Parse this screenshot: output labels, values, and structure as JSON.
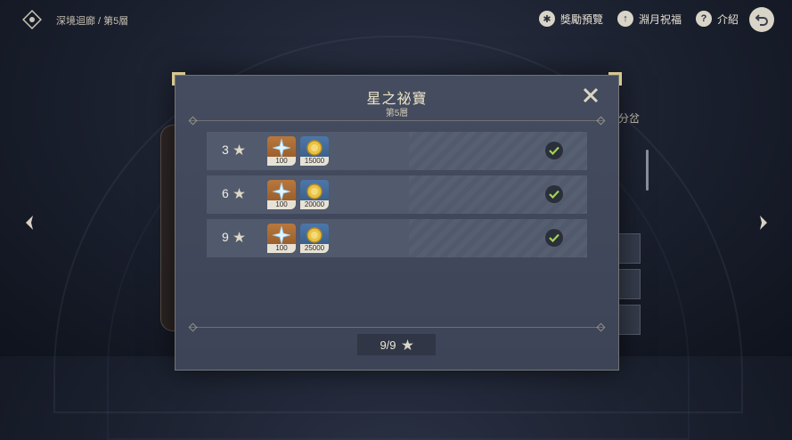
{
  "topbar": {
    "breadcrumb": "深境迴廊 / 第5層",
    "actions": [
      {
        "label": "獎勵預覽",
        "icon": "star-badge-icon"
      },
      {
        "label": "淵月祝福",
        "icon": "upload-arrow-icon"
      },
      {
        "label": "介紹",
        "icon": "question-icon"
      }
    ],
    "back_icon": "back-arrow-icon"
  },
  "background": {
    "right_label": "分岔"
  },
  "modal": {
    "title": "星之祕寶",
    "subtitle": "第5層",
    "rows": [
      {
        "stars": "3",
        "rewards": [
          {
            "type": "primogem",
            "qty": "100"
          },
          {
            "type": "mora",
            "qty": "15000"
          }
        ],
        "claimed": true
      },
      {
        "stars": "6",
        "rewards": [
          {
            "type": "primogem",
            "qty": "100"
          },
          {
            "type": "mora",
            "qty": "20000"
          }
        ],
        "claimed": true
      },
      {
        "stars": "9",
        "rewards": [
          {
            "type": "primogem",
            "qty": "100"
          },
          {
            "type": "mora",
            "qty": "25000"
          }
        ],
        "claimed": true
      }
    ],
    "progress": "9/9"
  },
  "colors": {
    "modal_bg": "#454c5f",
    "row_bg": "#555d70",
    "gem_bg": "#b9783c",
    "mora_bg": "#4d77aa",
    "accent_gold": "#d9c790",
    "check_green": "#9fd35a"
  }
}
